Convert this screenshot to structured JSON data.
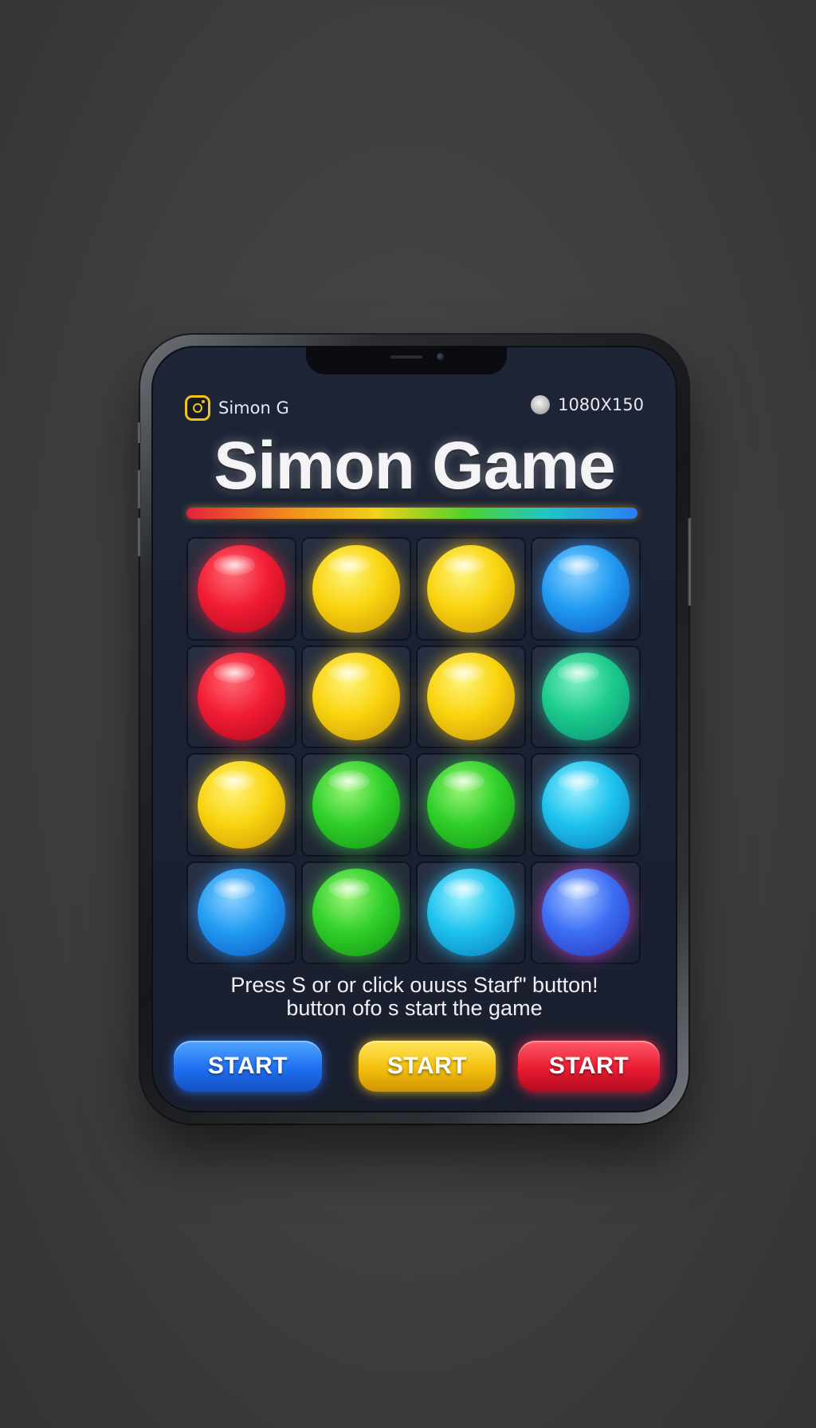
{
  "status_bar": {
    "app_name": "Simon G",
    "app_icon": "camera-icon",
    "resolution_icon": "circle-icon",
    "resolution": "1080X150"
  },
  "header": {
    "title": "Simon Game"
  },
  "progress": {
    "fraction": 1.0,
    "gradient": [
      "#e5203c",
      "#f2d21a",
      "#4fd22a",
      "#2c7df2"
    ]
  },
  "board": {
    "rows": [
      [
        "red",
        "yellow",
        "yellow",
        "blue"
      ],
      [
        "red",
        "yellow",
        "yellow",
        "teal"
      ],
      [
        "yellow",
        "green",
        "green",
        "cyan"
      ],
      [
        "blue",
        "green",
        "cyan",
        "violet"
      ]
    ],
    "colors": {
      "red": "#f21c34",
      "yellow": "#f9d40f",
      "blue": "#229cf2",
      "green": "#30d02a",
      "teal": "#1ccb8a",
      "cyan": "#1ec3ee",
      "violet": "#3d6ff5"
    }
  },
  "instructions": {
    "line1": "Press S or or click ouuss Starf\" button!",
    "line2": "button ofo s start the game"
  },
  "buttons": {
    "start_blue": "START",
    "start_yellow": "START",
    "start_red": "START"
  }
}
